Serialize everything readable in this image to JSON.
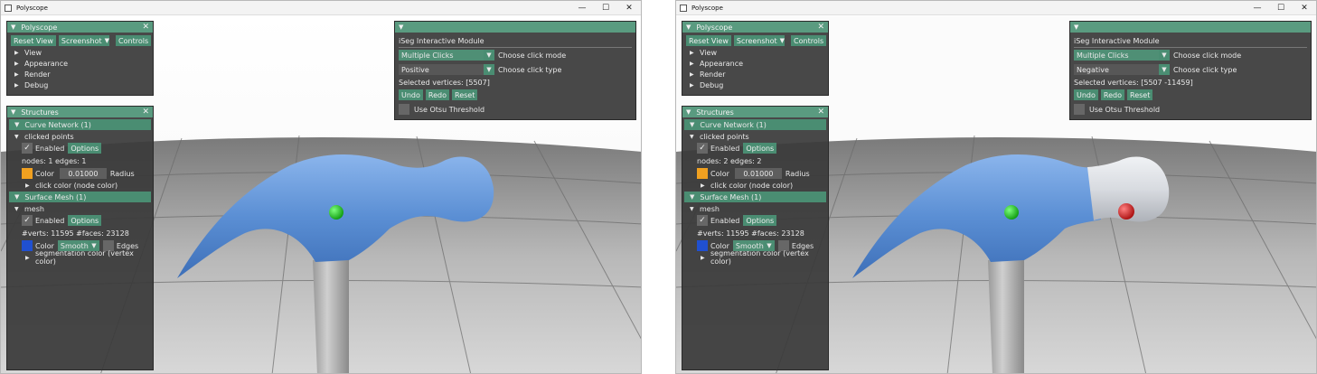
{
  "colors": {
    "accent": "#5a9b80",
    "panel_bg": "#3a3a3a",
    "mesh_blue": "#5b8fd4",
    "segment_white": "#d8dbe0",
    "point_green": "#1fc21f",
    "point_red": "#d91f1f",
    "node_color_swatch": "#f0a020",
    "surface_color_swatch": "#2050d0"
  },
  "windows": [
    {
      "title": "Polyscope",
      "controls": {
        "minimize": "—",
        "maximize": "☐",
        "close": "✕"
      },
      "polyscope_panel": {
        "title": "Polyscope",
        "close_glyph": "✕",
        "buttons": {
          "reset_view": "Reset View",
          "screenshot": "Screenshot",
          "screenshot_dd": "▼",
          "controls": "Controls"
        },
        "tree": [
          "View",
          "Appearance",
          "Render",
          "Debug"
        ]
      },
      "structures_panel": {
        "title": "Structures",
        "close_glyph": "✕",
        "curve_network": {
          "header": "Curve Network (1)",
          "name": "clicked points",
          "enabled_label": "Enabled",
          "options_label": "Options",
          "stats": "nodes: 1  edges: 1",
          "color_label": "Color",
          "radius_value": "0.01000",
          "radius_label": "Radius",
          "subnode": "click color (node color)"
        },
        "surface_mesh": {
          "header": "Surface Mesh (1)",
          "name": "mesh",
          "enabled_label": "Enabled",
          "options_label": "Options",
          "stats": "#verts: 11595  #faces: 23128",
          "color_label": "Color",
          "shade_value": "Smooth",
          "edges_label": "Edges",
          "subnode": "segmentation color (vertex color)"
        }
      },
      "iseg_panel": {
        "title": "iSeg Interactive Module",
        "click_mode_value": "Multiple Clicks",
        "click_mode_label": "Choose click mode",
        "click_type_value": "Positive",
        "click_type_label": "Choose click type",
        "selected": "Selected vertices: [5507]",
        "undo": "Undo",
        "redo": "Redo",
        "reset": "Reset",
        "otsu_label": "Use Otsu Threshold"
      },
      "scene": {
        "show_red_point": false,
        "segmented_head": false
      }
    },
    {
      "title": "Polyscope",
      "controls": {
        "minimize": "—",
        "maximize": "☐",
        "close": "✕"
      },
      "polyscope_panel": {
        "title": "Polyscope",
        "close_glyph": "✕",
        "buttons": {
          "reset_view": "Reset View",
          "screenshot": "Screenshot",
          "screenshot_dd": "▼",
          "controls": "Controls"
        },
        "tree": [
          "View",
          "Appearance",
          "Render",
          "Debug"
        ]
      },
      "structures_panel": {
        "title": "Structures",
        "close_glyph": "✕",
        "curve_network": {
          "header": "Curve Network (1)",
          "name": "clicked points",
          "enabled_label": "Enabled",
          "options_label": "Options",
          "stats": "nodes: 2  edges: 2",
          "color_label": "Color",
          "radius_value": "0.01000",
          "radius_label": "Radius",
          "subnode": "click color (node color)"
        },
        "surface_mesh": {
          "header": "Surface Mesh (1)",
          "name": "mesh",
          "enabled_label": "Enabled",
          "options_label": "Options",
          "stats": "#verts: 11595  #faces: 23128",
          "color_label": "Color",
          "shade_value": "Smooth",
          "edges_label": "Edges",
          "subnode": "segmentation color (vertex color)"
        }
      },
      "iseg_panel": {
        "title": "iSeg Interactive Module",
        "click_mode_value": "Multiple Clicks",
        "click_mode_label": "Choose click mode",
        "click_type_value": "Negative",
        "click_type_label": "Choose click type",
        "selected": "Selected vertices: [5507 -11459]",
        "undo": "Undo",
        "redo": "Redo",
        "reset": "Reset",
        "otsu_label": "Use Otsu Threshold"
      },
      "scene": {
        "show_red_point": true,
        "segmented_head": true
      }
    }
  ]
}
